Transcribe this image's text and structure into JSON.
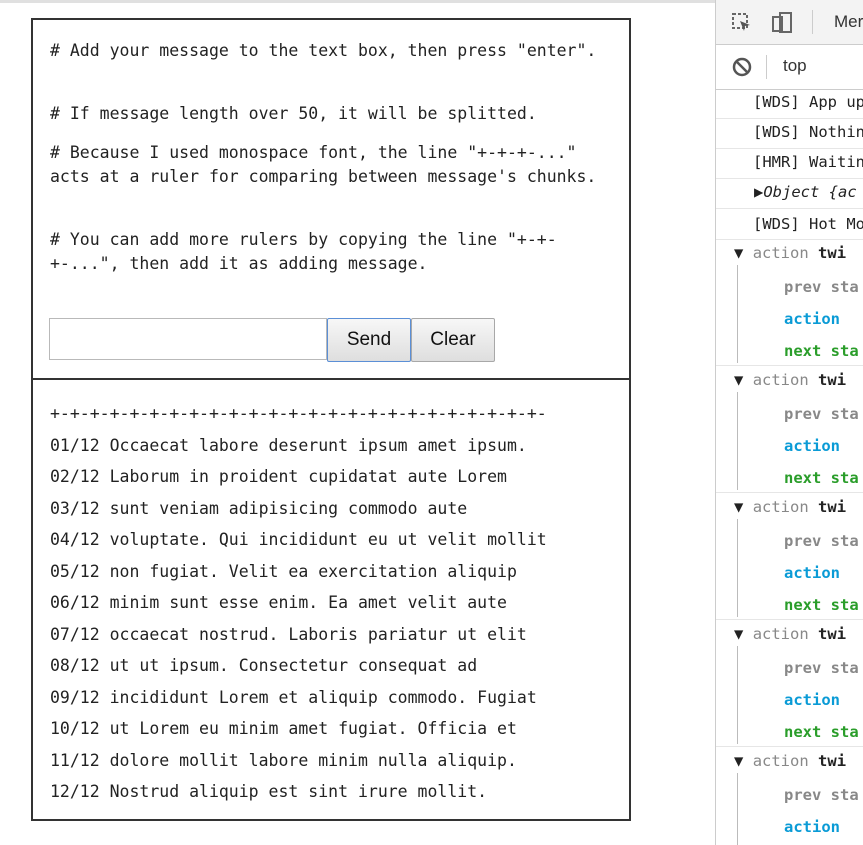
{
  "instructions": [
    "# Add your message to the text box, then press \"enter\".",
    "# If message length over 50, it will be splitted.",
    "# Because I used monospace font, the line \"+-+-+-...\" acts at a ruler for comparing between message's chunks.",
    "# You can add more rulers by copying the line \"+-+-+-...\", then add it as adding message."
  ],
  "form": {
    "input_value": "",
    "send_label": "Send",
    "clear_label": "Clear"
  },
  "messages": [
    "+-+-+-+-+-+-+-+-+-+-+-+-+-+-+-+-+-+-+-+-+-+-+-+-+-",
    "01/12 Occaecat labore deserunt ipsum amet ipsum.",
    "02/12 Laborum in proident cupidatat aute Lorem",
    "03/12 sunt veniam adipisicing commodo aute",
    "04/12 voluptate. Qui incididunt eu ut velit mollit",
    "05/12 non fugiat. Velit ea exercitation aliquip",
    "06/12 minim sunt esse enim. Ea amet velit aute",
    "07/12 occaecat nostrud. Laboris pariatur ut elit",
    "08/12 ut ut ipsum. Consectetur consequat ad",
    "09/12 incididunt Lorem et aliquip commodo. Fugiat",
    "10/12 ut Lorem eu minim amet fugiat. Officia et",
    "11/12 dolore mollit labore minim nulla aliquip.",
    "12/12 Nostrud aliquip est sint irure mollit."
  ],
  "devtools": {
    "tab_label": "Mer",
    "context": "top",
    "logs": [
      "[WDS] App up",
      "[WDS] Nothin",
      "[HMR] Waitin",
      "Object {ac",
      "[WDS] Hot Mo"
    ],
    "action_group": {
      "action_label": "action",
      "name": "twi",
      "prev": "prev sta",
      "action": "action",
      "next": "next sta"
    }
  }
}
